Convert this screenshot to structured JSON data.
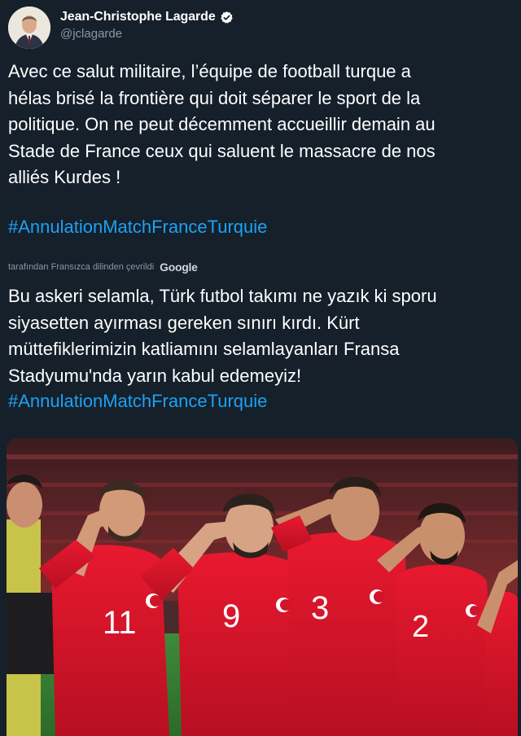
{
  "author": {
    "display_name": "Jean-Christophe Lagarde",
    "handle": "@jclagarde",
    "avatar_icon": "user-avatar-photo",
    "verified_icon": "verified-badge-icon"
  },
  "tweet": {
    "text": "Avec ce salut militaire, l’équipe de football turque a\nhélas brisé la frontière qui doit séparer le sport de la\npolitique. On ne peut décemment accueillir demain au\nStade de France ceux qui saluent le massacre de nos\nalliés Kurdes !",
    "hashtag": "#AnnulationMatchFranceTurquie"
  },
  "translation": {
    "note": "tarafından Fransızca dilinden çevrildi",
    "provider": "Google",
    "text": "Bu askeri selamla, Türk futbol takımı ne yazık ki sporu\nsiyasetten ayırması gereken sınırı kırdı. Kürt\nmüttefiklerimizin katliamını selamlayanları Fransa\nStadyumu'nda yarın kabul edemeyiz!",
    "hashtag": "#AnnulationMatchFranceTurquie"
  },
  "media": {
    "players": [
      {
        "number": "11"
      },
      {
        "number": "9"
      },
      {
        "number": "3"
      },
      {
        "number": "2"
      }
    ]
  },
  "colors": {
    "background": "#15202b",
    "link": "#1da1f2",
    "secondary_text": "#8899a6",
    "jersey_red": "#e0162b"
  }
}
